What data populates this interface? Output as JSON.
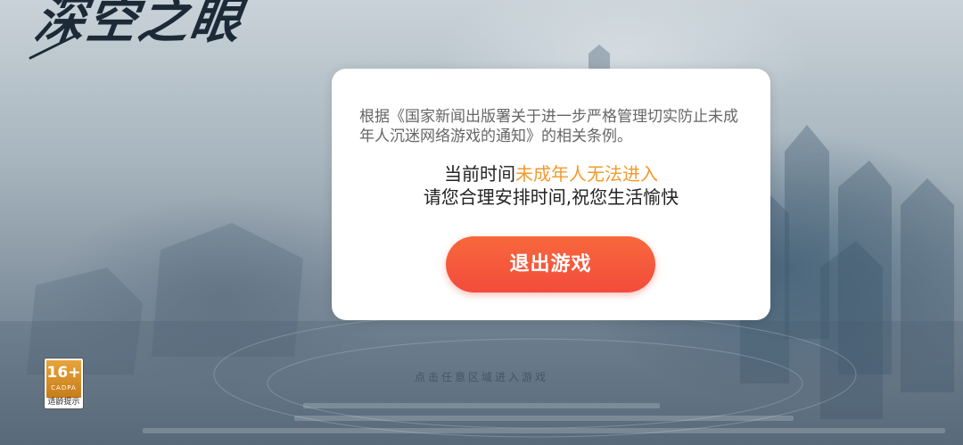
{
  "game": {
    "logo_text": "深空之眼"
  },
  "dialog": {
    "notice": "根据《国家新闻出版署关于进一步严格管理切实防止未成年人沉迷网络游戏的通知》的相关条例。",
    "message_prefix": "当前时间",
    "message_highlight": "未成年人无法进入",
    "message_line2": "请您合理安排时间,祝您生活愉快",
    "exit_label": "退出游戏"
  },
  "age_rating": {
    "age": "16+",
    "org": "CADPA",
    "tip": "适龄提示"
  },
  "footer": {
    "tap_hint": "点击任意区域进入游戏"
  },
  "colors": {
    "highlight": "#f39a2e",
    "button_top": "#f8683c",
    "button_bottom": "#f24c3c"
  }
}
